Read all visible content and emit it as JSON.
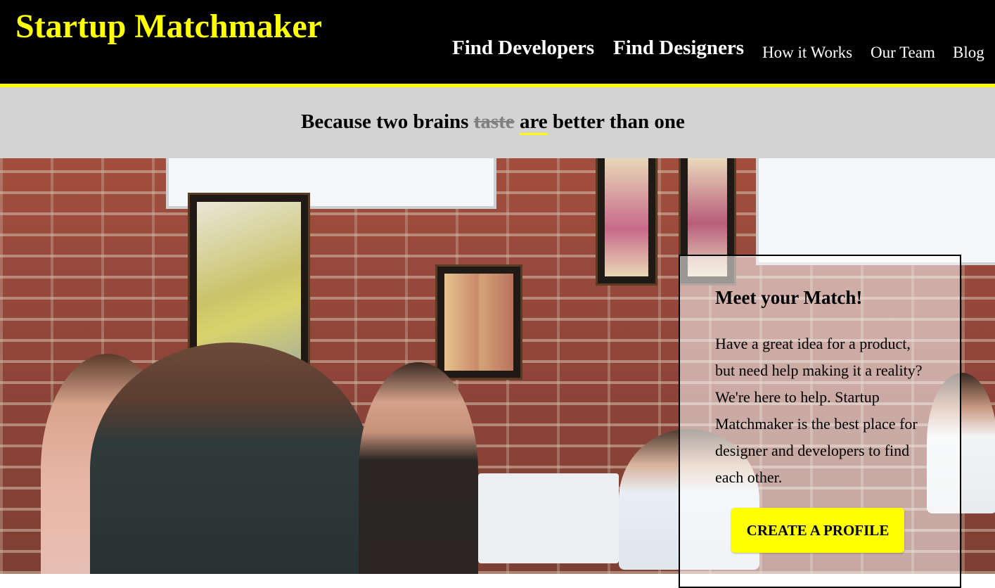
{
  "header": {
    "brand": "Startup Matchmaker",
    "nav": {
      "find_developers": "Find Developers",
      "find_designers": "Find Designers",
      "how_it_works": "How it Works",
      "our_team": "Our Team",
      "blog": "Blog"
    }
  },
  "tagline": {
    "before": "Because two brains ",
    "struck": "taste",
    "highlight": "are",
    "after": " better than one"
  },
  "hero": {
    "image": "photo of people working on laptops in a café with brick wall and framed art"
  },
  "card": {
    "title": "Meet your Match!",
    "body": "Have a great idea for a product, but need help making it a reality? We're here to help. Startup Matchmaker is the best place for designer and developers to find each other.",
    "cta_label": "CREATE A PROFILE"
  },
  "colors": {
    "header_bg": "#000000",
    "accent_yellow": "#ffff00",
    "band_gray": "#d3d3d3",
    "struck_gray": "#808080"
  }
}
